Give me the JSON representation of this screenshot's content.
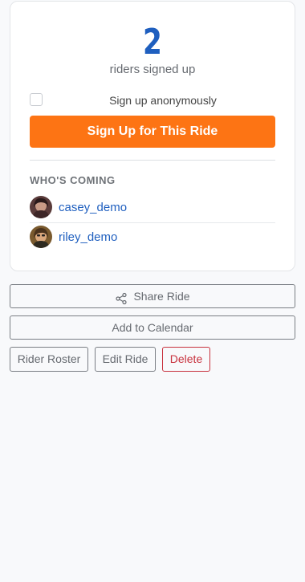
{
  "ride": {
    "signup_count": "2",
    "signup_count_label": "riders signed up",
    "anonymous_label": "Sign up anonymously",
    "anonymous_checked": false,
    "signup_button_label": "Sign Up for This Ride"
  },
  "whos_coming": {
    "title": "WHO'S COMING",
    "riders": [
      {
        "username": "casey_demo",
        "avatar_icon": "avatar-photo-icon"
      },
      {
        "username": "riley_demo",
        "avatar_icon": "avatar-photo-icon"
      }
    ]
  },
  "actions": {
    "share_label": "Share Ride",
    "share_icon": "share-icon",
    "calendar_label": "Add to Calendar",
    "roster_label": "Rider Roster",
    "edit_label": "Edit Ride",
    "delete_label": "Delete"
  },
  "colors": {
    "accent_blue": "#1f5fbf",
    "signup_orange": "#fd7414",
    "danger_red": "#c8323e"
  }
}
